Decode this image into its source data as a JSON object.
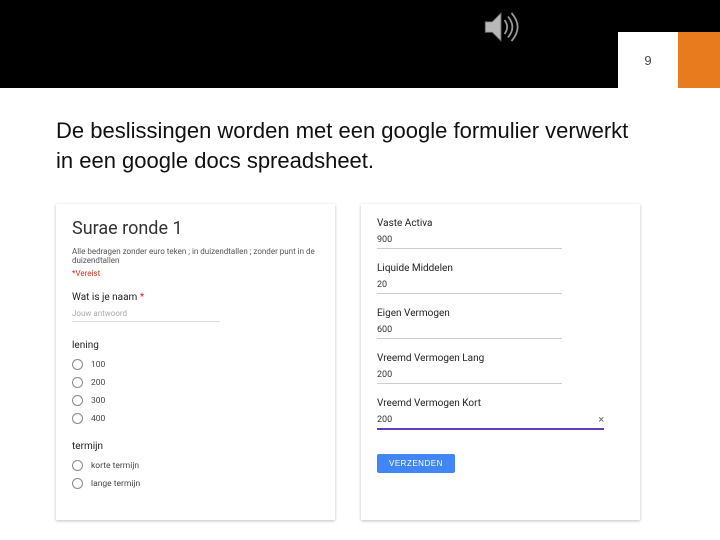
{
  "page_number": "9",
  "title": "De beslissingen worden met een google formulier verwerkt in een google docs spreadsheet.",
  "left_form": {
    "title": "Surae ronde 1",
    "desc": "Alle bedragen zonder euro teken ; in duizendtallen ; zonder punt in de duizendtallen",
    "required": "*Vereist",
    "q_name": "Wat is je naam",
    "asterisk": "*",
    "placeholder": "Jouw antwoord",
    "group1_label": "lening",
    "group1_opts": [
      "100",
      "200",
      "300",
      "400"
    ],
    "group2_label": "termijn",
    "group2_opts": [
      "korte termijn",
      "lange termijn"
    ]
  },
  "right_form": {
    "fields": [
      {
        "label": "Vaste Activa",
        "value": "900"
      },
      {
        "label": "Liquide Middelen",
        "value": "20"
      },
      {
        "label": "Eigen Vermogen",
        "value": "600"
      },
      {
        "label": "Vreemd Vermogen Lang",
        "value": "200"
      }
    ],
    "active_field": {
      "label": "Vreemd Vermogen Kort",
      "value": "200",
      "clear": "×"
    },
    "submit": "VERZENDEN"
  }
}
